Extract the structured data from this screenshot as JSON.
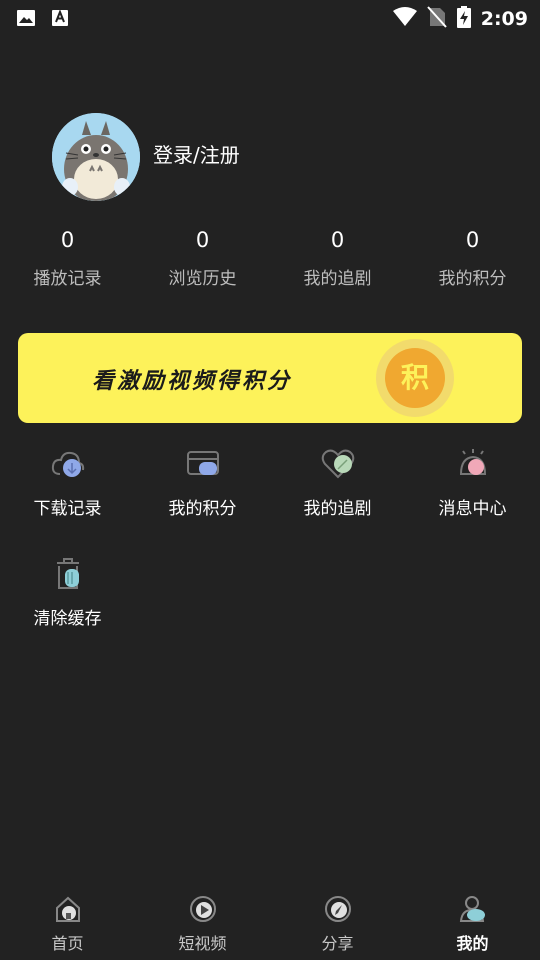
{
  "status_bar": {
    "time": "2:09",
    "icons": [
      "image-icon",
      "font-icon",
      "wifi-icon",
      "no-sim-icon",
      "battery-charging-icon"
    ]
  },
  "profile": {
    "login_label": "登录/注册"
  },
  "stats": [
    {
      "value": "0",
      "label": "播放记录"
    },
    {
      "value": "0",
      "label": "浏览历史"
    },
    {
      "value": "0",
      "label": "我的追剧"
    },
    {
      "value": "0",
      "label": "我的积分"
    }
  ],
  "banner": {
    "text": "看激励视频得积分",
    "coin_label": "积",
    "colors": {
      "background": "#fdf25a",
      "coin": "#f0a830"
    }
  },
  "menu": [
    {
      "label": "下载记录",
      "icon": "cloud-download-icon"
    },
    {
      "label": "我的积分",
      "icon": "wallet-icon"
    },
    {
      "label": "我的追剧",
      "icon": "heart-icon"
    },
    {
      "label": "消息中心",
      "icon": "bell-icon"
    },
    {
      "label": "清除缓存",
      "icon": "trash-icon"
    }
  ],
  "bottom_nav": [
    {
      "label": "首页",
      "icon": "home-icon"
    },
    {
      "label": "短视频",
      "icon": "play-circle-icon"
    },
    {
      "label": "分享",
      "icon": "compass-icon"
    },
    {
      "label": "我的",
      "icon": "user-icon",
      "active": true
    }
  ]
}
